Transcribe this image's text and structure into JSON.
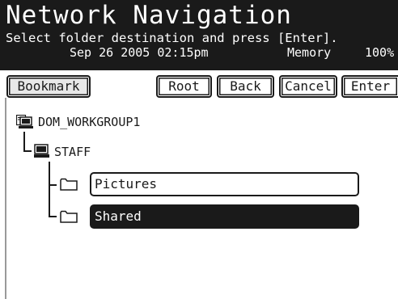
{
  "header": {
    "title": "Network Navigation",
    "instruction": "Select folder destination and press [Enter].",
    "status": {
      "datetime": "Sep 26 2005 02:15pm",
      "memory_label": "Memory",
      "memory_value": "100%"
    }
  },
  "toolbar": {
    "bookmark_label": "Bookmark",
    "root_label": "Root",
    "back_label": "Back",
    "cancel_label": "Cancel",
    "enter_label": "Enter"
  },
  "tree": {
    "workgroup": {
      "label": "DOM_WORKGROUP1",
      "icon": "network-workgroup-icon"
    },
    "computer": {
      "label": "STAFF",
      "icon": "computer-icon"
    },
    "folders": [
      {
        "label": "Pictures",
        "icon": "folder-icon",
        "selected": false
      },
      {
        "label": "Shared",
        "icon": "folder-icon",
        "selected": true
      }
    ]
  },
  "colors": {
    "foreground": "#1a1a1a",
    "background": "#ffffff",
    "selected_background": "#1a1a1a",
    "selected_text": "#ffffff"
  }
}
